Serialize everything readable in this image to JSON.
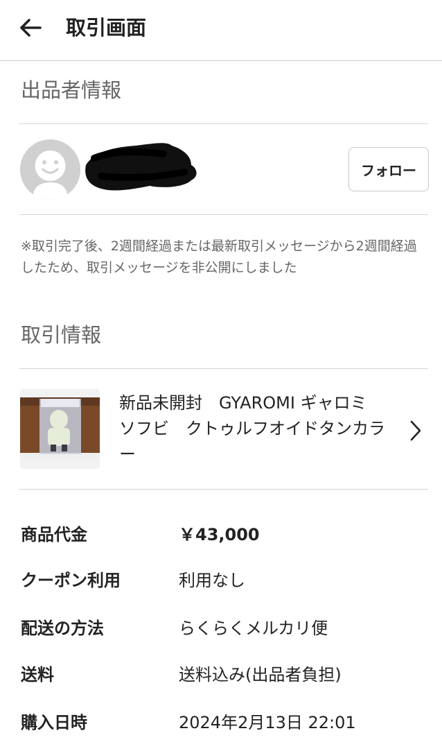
{
  "header": {
    "title": "取引画面"
  },
  "seller_section": {
    "title": "出品者情報",
    "follow_label": "フォロー",
    "notice": "※取引完了後、2週間経過または最新取引メッセージから2週間経過したため、取引メッセージを非公開にしました"
  },
  "transaction_section": {
    "title": "取引情報",
    "product_title": "新品未開封　GYAROMI ギャロミ　ソフビ　クトゥルフオイドタンカラー"
  },
  "details": [
    {
      "label": "商品代金",
      "value": "￥43,000"
    },
    {
      "label": "クーポン利用",
      "value": "利用なし"
    },
    {
      "label": "配送の方法",
      "value": "らくらくメルカリ便"
    },
    {
      "label": "送料",
      "value": "送料込み(出品者負担)"
    },
    {
      "label": "購入日時",
      "value": "2024年2月13日 22:01"
    }
  ],
  "colors": {
    "text": "#222222",
    "muted": "#666666",
    "divider": "#d4d4d4",
    "avatar": "#d0d0d0"
  },
  "icons": {
    "back": "arrow-left-icon",
    "chevron": "chevron-right-icon",
    "avatar": "default-avatar-icon"
  }
}
